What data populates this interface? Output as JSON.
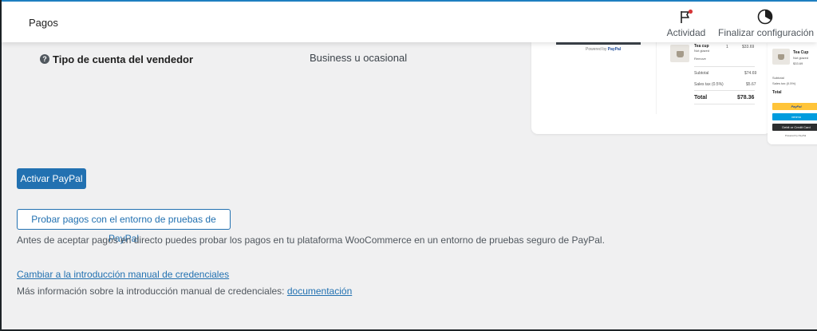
{
  "header": {
    "title": "Pagos",
    "activity_label": "Actividad",
    "setup_label": "Finalizar configuración",
    "notification_color": "#d63638"
  },
  "account": {
    "label": "Tipo de cuenta del vendedor",
    "value": "Business u ocasional"
  },
  "preview": {
    "powered_by": "Powered by",
    "paypal_brand": "PayPal",
    "product_name": "Tea cup",
    "product_variant": "Not glazed",
    "product_qty": "1",
    "product_price": "$33.69",
    "remove": "Remove",
    "subtotal_label": "Subtotal",
    "subtotal_value": "$74.69",
    "tax_label": "Sales tax (0.5%)",
    "tax_value": "$5.67",
    "total_label": "Total",
    "total_value": "$78.36",
    "mobile": {
      "product_name": "Tea Cup",
      "product_variant": "Not glazed",
      "product_price": "$33.69",
      "subtotal_label": "Subtotal",
      "tax_label": "Sales tax (0.5%)",
      "total_label": "Total",
      "paypal_button": "PayPal",
      "venmo_button": "venmo",
      "card_button": "Debit or Credit Card",
      "powered_by": "Powered by PayPal"
    }
  },
  "actions": {
    "activate_label": "Activar PayPal",
    "sandbox_label": "Probar pagos con el entorno de pruebas de PayPal",
    "sandbox_description": "Antes de aceptar pagos en directo puedes probar los pagos en tu plataforma WooCommerce en un entorno de pruebas seguro de PayPal.",
    "manual_link": "Cambiar a la introducción manual de credenciales",
    "more_info_text": "Más información sobre la introducción manual de credenciales:",
    "docs_link": "documentación"
  },
  "colors": {
    "primary": "#2271b1",
    "paypal_yellow": "#ffc439",
    "venmo_blue": "#009cde"
  }
}
